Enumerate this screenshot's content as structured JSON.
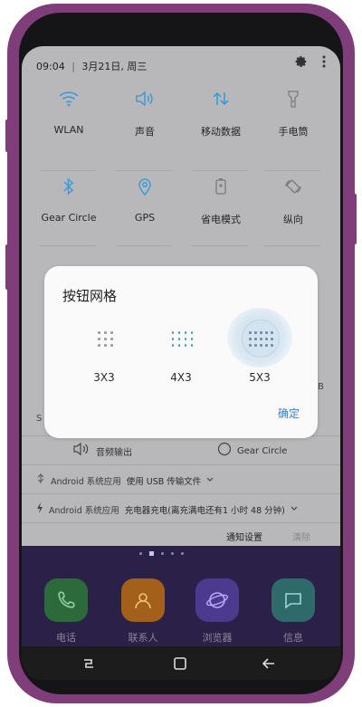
{
  "status_bar": {
    "time": "09:04",
    "date": "3月21日, 周三"
  },
  "quick_tiles": [
    {
      "label": "WLAN",
      "icon": "wifi-icon",
      "active": true
    },
    {
      "label": "声音",
      "icon": "volume-icon",
      "active": true
    },
    {
      "label": "移动数据",
      "icon": "data-arrows-icon",
      "active": true
    },
    {
      "label": "手电筒",
      "icon": "flashlight-icon",
      "active": false
    },
    {
      "label": "Gear Circle",
      "icon": "bluetooth-icon",
      "active": true
    },
    {
      "label": "GPS",
      "icon": "location-icon",
      "active": true
    },
    {
      "label": "省电模式",
      "icon": "battery-saver-icon",
      "active": false
    },
    {
      "label": "纵向",
      "icon": "rotate-icon",
      "active": false
    }
  ],
  "media_row": {
    "audio_output": "音频输出",
    "gear_circle": "Gear Circle"
  },
  "notifications": [
    {
      "app": "Android 系统应用",
      "text": "使用 USB 传输文件",
      "icon": "usb-icon"
    },
    {
      "app": "Android 系统应用",
      "text": "充电器充电(离充满电还有1 小时 48 分钟)",
      "icon": "charging-icon"
    }
  ],
  "bottom_links": {
    "settings": "通知设置",
    "clear": "清除"
  },
  "peek_letter": "S",
  "peek_right": "B",
  "dialog": {
    "title": "按钮网格",
    "options": [
      {
        "label": "3X3",
        "cols": 3,
        "rows": 3,
        "selected": false
      },
      {
        "label": "4X3",
        "cols": 4,
        "rows": 3,
        "selected": false
      },
      {
        "label": "5X3",
        "cols": 5,
        "rows": 3,
        "selected": true
      }
    ],
    "confirm": "确定"
  },
  "dock": [
    {
      "label": "电话",
      "icon": "phone-icon",
      "color": "#2c6a3b"
    },
    {
      "label": "联系人",
      "icon": "contacts-icon",
      "color": "#a2601a"
    },
    {
      "label": "浏览器",
      "icon": "browser-icon",
      "color": "#4c3a8e"
    },
    {
      "label": "信息",
      "icon": "messages-icon",
      "color": "#2f6a6a"
    }
  ],
  "colors": {
    "accent": "#3a9bd9",
    "dialog_accent": "#3a7fc4",
    "frame": "#7f3d7a",
    "home_bg": "#2b2048"
  }
}
